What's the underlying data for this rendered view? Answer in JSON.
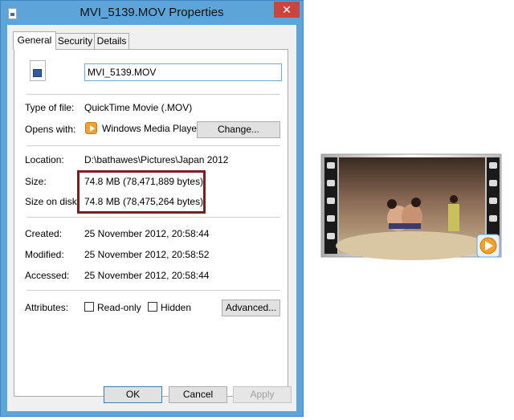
{
  "window": {
    "title": "MVI_5139.MOV Properties",
    "close_glyph": "✕"
  },
  "tabs": [
    {
      "label": "General",
      "active": true
    },
    {
      "label": "Security",
      "active": false
    },
    {
      "label": "Details",
      "active": false
    }
  ],
  "file": {
    "name": "MVI_5139.MOV",
    "icon": "video-file-icon"
  },
  "details": {
    "type_label": "Type of file:",
    "type_value": "QuickTime Movie (.MOV)",
    "opens_label": "Opens with:",
    "opens_value": "Windows Media Player",
    "change_label": "Change...",
    "location_label": "Location:",
    "location_value": "D:\\bathawes\\Pictures\\Japan 2012",
    "size_label": "Size:",
    "size_value": "74.8 MB (78,471,889 bytes)",
    "disk_label": "Size on disk:",
    "disk_value": "74.8 MB (78,475,264 bytes)",
    "created_label": "Created:",
    "created_value": "25 November 2012, 20:58:44",
    "modified_label": "Modified:",
    "modified_value": "25 November 2012, 20:58:52",
    "accessed_label": "Accessed:",
    "accessed_value": "25 November 2012, 20:58:44",
    "attributes_label": "Attributes:",
    "readonly_label": "Read-only",
    "hidden_label": "Hidden",
    "advanced_label": "Advanced..."
  },
  "footer": {
    "ok_label": "OK",
    "cancel_label": "Cancel",
    "apply_label": "Apply"
  },
  "colors": {
    "highlight_border": "#7a1f24",
    "window_frame": "#5da4d9",
    "close_button": "#c9463d"
  }
}
